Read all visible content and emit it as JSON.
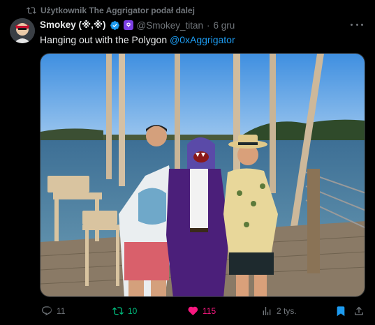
{
  "repost_header": {
    "text": "Użytkownik The Aggrigator podał dalej"
  },
  "author": {
    "display_name": "Smokey (※,※)",
    "handle": "@Smokey_titan",
    "separator": "·",
    "date": "6 gru"
  },
  "tweet": {
    "text": "Hanging out with the Polygon ",
    "mention": "@0xAggrigator"
  },
  "actions": {
    "replies": "11",
    "reposts": "10",
    "likes": "115",
    "views": "2 tys."
  },
  "colors": {
    "accent": "#1d9bf0",
    "repost_active": "#00ba7c",
    "like_active": "#f91880",
    "muted": "#71767b",
    "affiliate_badge": "#7b3fe4"
  },
  "icons": [
    "repost-icon",
    "verified-badge-icon",
    "affiliate-icon",
    "more-icon",
    "reply-icon",
    "like-icon",
    "views-icon",
    "bookmark-icon",
    "share-icon"
  ]
}
